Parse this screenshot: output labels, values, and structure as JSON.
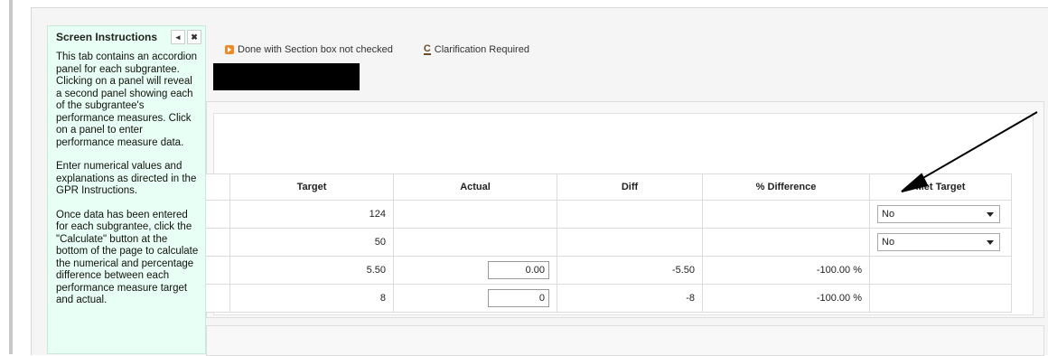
{
  "instructions": {
    "title": "Screen Instructions",
    "collapse_glyph": "◂",
    "close_glyph": "✖",
    "paragraph_1": "This tab contains an accordion panel for each subgrantee.  Clicking on a panel will reveal a second panel showing each of the subgrantee's performance measures.  Click on a panel to enter performance measure data.",
    "paragraph_2": "Enter numerical values and explanations as directed in the GPR Instructions.",
    "paragraph_3": "Once data has been entered for each subgrantee, click the \"Calculate\" button at the bottom of the page to calculate the numerical and percentage difference between each performance measure target and actual."
  },
  "legend": {
    "done_label": "Done with Section box not checked",
    "clarification_icon": "C",
    "clarification_label": "Clarification Required",
    "done_color": "#f08a24"
  },
  "table": {
    "headers": {
      "target": "Target",
      "actual": "Actual",
      "diff": "Diff",
      "pct": "% Difference",
      "met": "Met Target"
    },
    "rows": [
      {
        "target": "124",
        "actual": "",
        "diff": "",
        "pct": "",
        "met": "No"
      },
      {
        "target": "50",
        "actual": "",
        "diff": "",
        "pct": "",
        "met": "No"
      },
      {
        "target": "5.50",
        "actual": "0.00",
        "diff": "-5.50",
        "pct": "-100.00 %",
        "met": ""
      },
      {
        "target": "8",
        "actual": "0",
        "diff": "-8",
        "pct": "-100.00 %",
        "met": ""
      }
    ]
  }
}
